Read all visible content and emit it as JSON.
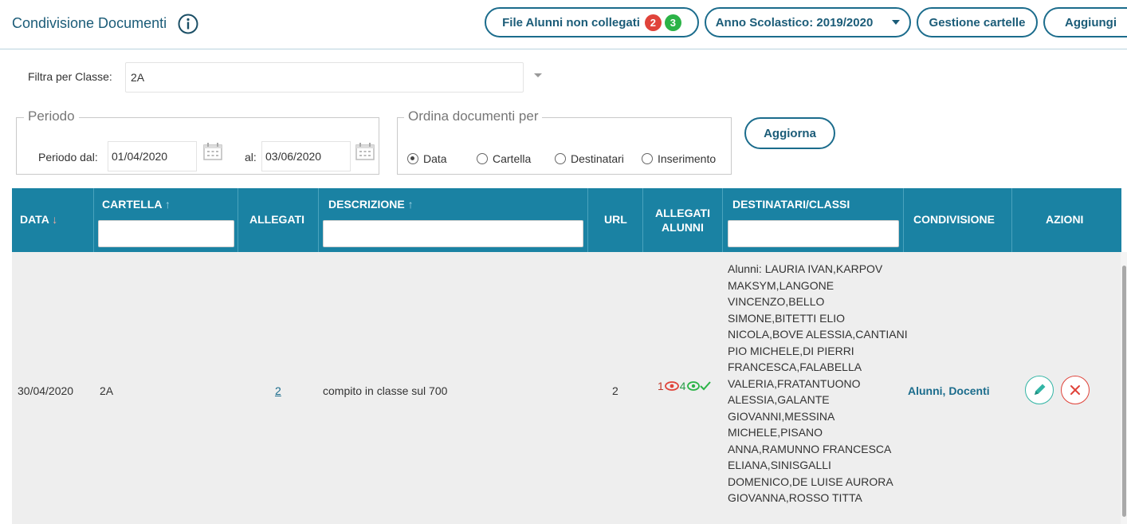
{
  "header": {
    "title": "Condivisione Documenti",
    "file_alunni_label": "File Alunni non collegati",
    "badge_red": "2",
    "badge_green": "3",
    "anno_label": "Anno Scolastico: 2019/2020",
    "gestione_label": "Gestione cartelle",
    "aggiungi_label": "Aggiungi"
  },
  "filter": {
    "label": "Filtra per Classe:",
    "value": "2A"
  },
  "periodo": {
    "legend": "Periodo",
    "from_label": "Periodo dal:",
    "from_value": "01/04/2020",
    "to_label": "al:",
    "to_value": "03/06/2020"
  },
  "ordina": {
    "legend": "Ordina documenti per",
    "options": [
      "Data",
      "Cartella",
      "Destinatari",
      "Inserimento"
    ],
    "selected": "Data"
  },
  "aggiorna_label": "Aggiorna",
  "table": {
    "headers": {
      "data": "DATA",
      "cartella": "CARTELLA",
      "allegati": "ALLEGATI",
      "descrizione": "DESCRIZIONE",
      "url": "URL",
      "allegati_alunni_1": "ALLEGATI",
      "allegati_alunni_2": "ALUNNI",
      "destinatari": "DESTINATARI/CLASSI",
      "condivisione": "CONDIVISIONE",
      "azioni": "AZIONI"
    },
    "sort_up": "↑",
    "sort_down": "↓",
    "rows": [
      {
        "data": "30/04/2020",
        "cartella": "2A",
        "allegati": "2",
        "descrizione": "compito in classe sul 700",
        "url": "2",
        "allegati_alunni_a": "1",
        "allegati_alunni_b": "4",
        "destinatari": "Alunni: LAURIA IVAN,KARPOV MAKSYM,LANGONE VINCENZO,BELLO SIMONE,BITETTI ELIO NICOLA,BOVE ALESSIA,CANTIANI PIO MICHELE,DI PIERRI FRANCESCA,FALABELLA VALERIA,FRATANTUONO ALESSIA,GALANTE GIOVANNI,MESSINA MICHELE,PISANO ANNA,RAMUNNO FRANCESCA ELIANA,SINISGALLI DOMENICO,DE LUISE AURORA GIOVANNA,ROSSO TITTA",
        "condivisione": "Alunni, Docenti"
      }
    ]
  },
  "colors": {
    "table_header": "#1a82a3",
    "primary": "#1b6c8c",
    "badge_red": "#e0433a",
    "badge_green": "#2bb347",
    "edit": "#33b5a5",
    "delete": "#e0433a"
  },
  "icons": [
    "info-icon",
    "calendar-icon",
    "eye-icon",
    "check-icon",
    "pencil-icon",
    "close-icon",
    "chevron-down-icon"
  ]
}
